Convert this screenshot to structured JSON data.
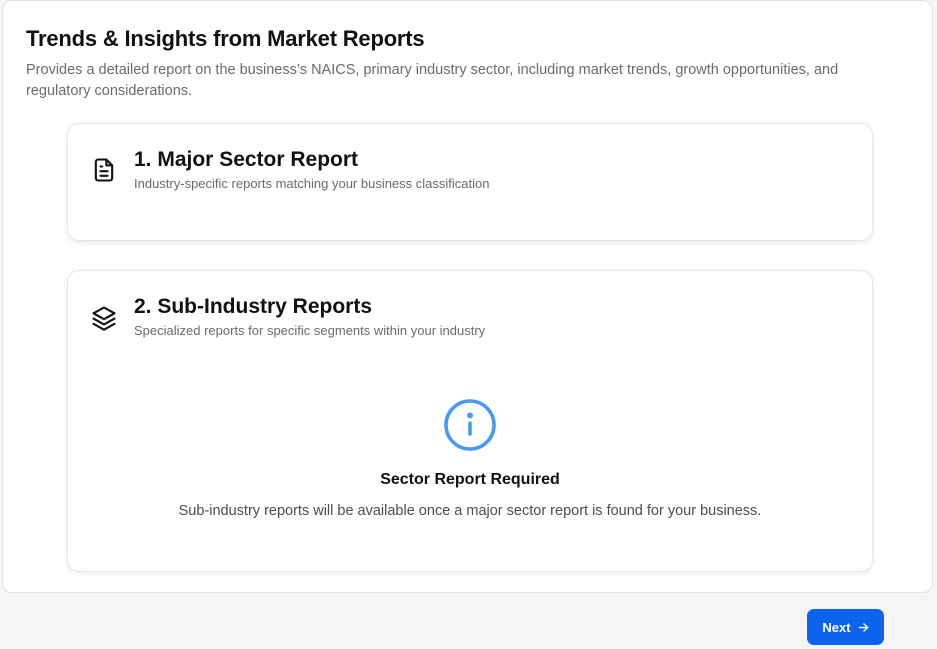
{
  "header": {
    "title": "Trends & Insights from Market Reports",
    "description": "Provides a detailed report on the business’s NAICS, primary industry sector, including market trends, growth opportunities, and regulatory considerations."
  },
  "cards": [
    {
      "title": "1. Major Sector Report",
      "subtitle": "Industry-specific reports matching your business classification",
      "icon": "document-icon"
    },
    {
      "title": "2. Sub-Industry Reports",
      "subtitle": "Specialized reports for specific segments within your industry",
      "icon": "layers-icon",
      "notice": {
        "icon": "info-icon",
        "title": "Sector Report Required",
        "text": "Sub-industry reports will be available once a major sector report is found for your business."
      }
    }
  ],
  "footer": {
    "next_label": "Next",
    "next_icon": "arrow-right-icon"
  },
  "colors": {
    "accent": "#0b63f0",
    "info": "#4a9af5"
  }
}
